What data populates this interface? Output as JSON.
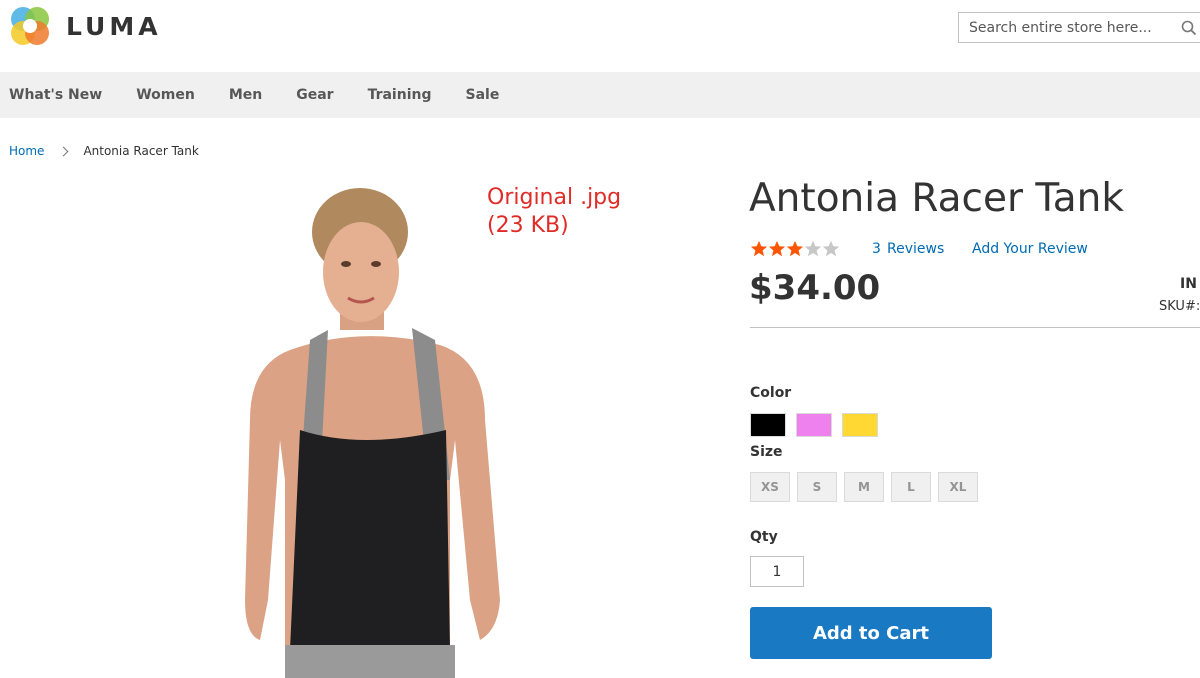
{
  "header": {
    "logo_text": "LUMA",
    "search_placeholder": "Search entire store here..."
  },
  "nav": {
    "items": [
      "What's New",
      "Women",
      "Men",
      "Gear",
      "Training",
      "Sale"
    ]
  },
  "breadcrumb": {
    "home": "Home",
    "current": "Antonia Racer Tank"
  },
  "annotation": {
    "text": "Original .jpg\n(23 KB)"
  },
  "product": {
    "name": "Antonia Racer Tank",
    "rating_stars": 3,
    "rating_max": 5,
    "reviews_count": "3",
    "reviews_label": "Reviews",
    "add_review_label": "Add Your Review",
    "price": "$34.00",
    "stock": "IN",
    "sku_label": "SKU#:",
    "color_label": "Color",
    "colors": [
      "#000000",
      "#ef81ef",
      "#ffd834"
    ],
    "size_label": "Size",
    "sizes": [
      "XS",
      "S",
      "M",
      "L",
      "XL"
    ],
    "qty_label": "Qty",
    "qty_value": "1",
    "add_to_cart_label": "Add to Cart"
  },
  "icons": {
    "search": "search-icon",
    "logo": "luma-logo-icon",
    "chevron": "chevron-right-icon",
    "star": "star-icon"
  },
  "colors": {
    "accent": "#1979c3",
    "link": "#006bb4",
    "star_filled": "#ff5501",
    "star_empty": "#c7c7c7",
    "annotation": "#e02b27"
  }
}
